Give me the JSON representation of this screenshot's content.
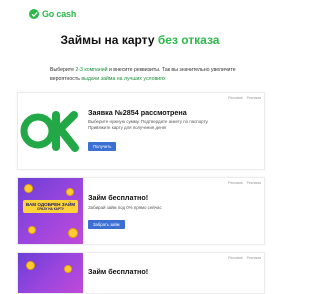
{
  "header": {
    "logo_text": "Go cash",
    "logo_icon": "check-circle-icon"
  },
  "main": {
    "title_part1": "Займы на карту",
    "title_part2": "без отказа",
    "intro_part1": "Выберите",
    "intro_link1": "2-3 компаний",
    "intro_part2": "и внесите реквизиты. Так вы значительно увеличите вероятность",
    "intro_link2": "выдачи займа на лучших условиях",
    "accent_color": "#2db84b",
    "button_color": "#3b6fd4"
  },
  "cards": [
    {
      "image": "ok-logo",
      "menu_left": "Реклама",
      "menu_right": "Реклама",
      "title": "Заявка №2854 рассмотрена",
      "description": "Выберите нужную сумму. Подтвердите анкету по паспорту. Привяжите карту для получения денег",
      "button": "Получить"
    },
    {
      "image": "promo-banner",
      "banner_line1": "ВАМ ОДОБРЕН ЗАЙМ",
      "banner_line2": "СРАЗУ НА КАРТУ",
      "menu_left": "Реклама",
      "menu_right": "Реклама",
      "title": "Займ бесплатно!",
      "description": "Забирай займ под 0% прямо сейчас",
      "button": "Забрать займ"
    },
    {
      "image": "promo-banner",
      "menu_left": "Реклама",
      "menu_right": "Реклама",
      "title": "Займ бесплатно!"
    }
  ]
}
